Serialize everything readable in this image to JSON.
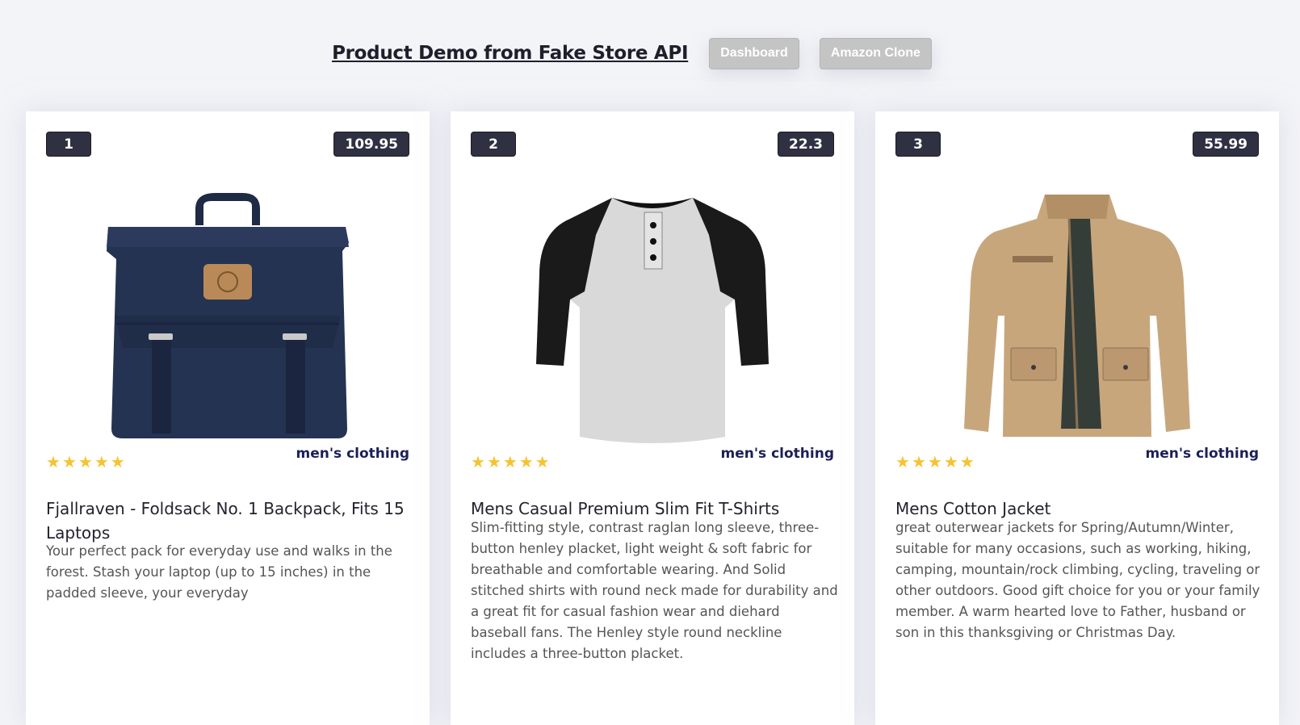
{
  "header": {
    "title": "Product Demo from Fake Store API",
    "buttons": [
      {
        "label": "Dashboard"
      },
      {
        "label": "Amazon Clone"
      }
    ]
  },
  "products": [
    {
      "id": "1",
      "price": "109.95",
      "rating_stars": 5,
      "category": "men's clothing",
      "title": "Fjallraven - Foldsack No. 1 Backpack, Fits 15 Laptops",
      "description": "Your perfect pack for everyday use and walks in the forest. Stash your laptop (up to 15 inches) in the padded sleeve, your everyday",
      "image_icon": "backpack-image"
    },
    {
      "id": "2",
      "price": "22.3",
      "rating_stars": 5,
      "category": "men's clothing",
      "title": "Mens Casual Premium Slim Fit T-Shirts",
      "description": "Slim-fitting style, contrast raglan long sleeve, three-button henley placket, light weight & soft fabric for breathable and comfortable wearing. And Solid stitched shirts with round neck made for durability and a great fit for casual fashion wear and diehard baseball fans. The Henley style round neckline includes a three-button placket.",
      "image_icon": "tshirt-image"
    },
    {
      "id": "3",
      "price": "55.99",
      "rating_stars": 5,
      "category": "men's clothing",
      "title": "Mens Cotton Jacket",
      "description": "great outerwear jackets for Spring/Autumn/Winter, suitable for many occasions, such as working, hiking, camping, mountain/rock climbing, cycling, traveling or other outdoors. Good gift choice for you or your family member. A warm hearted love to Father, husband or son in this thanksgiving or Christmas Day.",
      "image_icon": "jacket-image"
    }
  ],
  "colors": {
    "badge_bg": "#2f3142",
    "category": "#1c2057",
    "star": "#f4c430",
    "nav_btn": "#c4c4c4"
  }
}
